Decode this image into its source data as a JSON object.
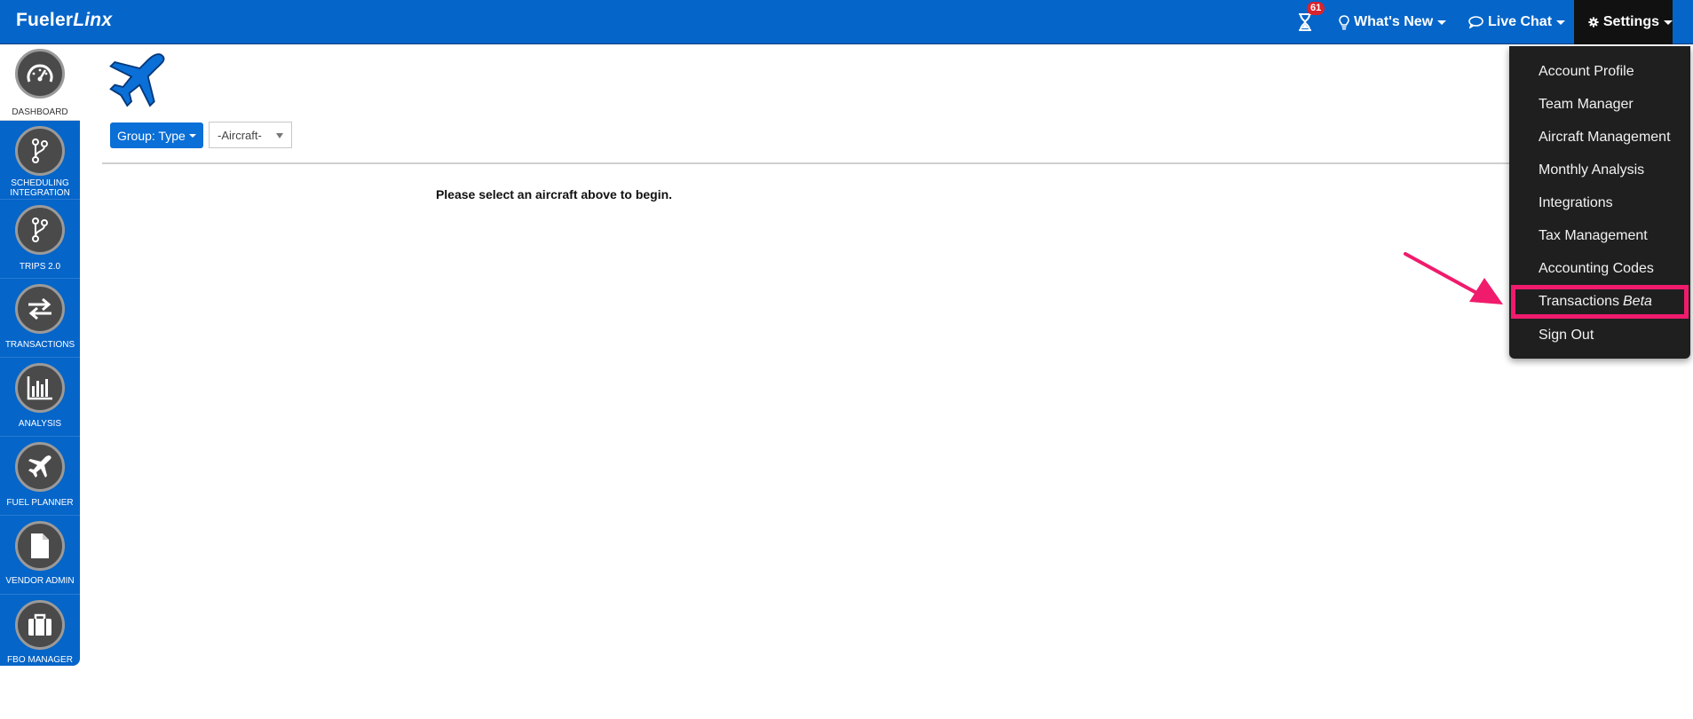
{
  "brand": {
    "part1": "Fueler",
    "part2": "Linx"
  },
  "topnav": {
    "notification_count": "61",
    "whats_new": "What's New",
    "live_chat": "Live Chat",
    "settings": "Settings"
  },
  "sidebar": {
    "items": [
      {
        "label": "Dashboard",
        "icon": "speedometer-icon"
      },
      {
        "label": "Scheduling Integration",
        "icon": "branch-icon"
      },
      {
        "label": "Trips 2.0",
        "icon": "branch-icon"
      },
      {
        "label": "Transactions",
        "icon": "exchange-icon"
      },
      {
        "label": "Analysis",
        "icon": "bar-chart-icon"
      },
      {
        "label": "Fuel Planner",
        "icon": "plane-icon"
      },
      {
        "label": "Vendor Admin",
        "icon": "document-icon"
      },
      {
        "label": "FBO Manager",
        "icon": "briefcase-icon"
      }
    ]
  },
  "toolbar": {
    "group_button": "Group: Type",
    "aircraft_select": "-Aircraft-"
  },
  "main": {
    "message": "Please select an aircraft above to begin."
  },
  "settings_menu": {
    "items": [
      "Account Profile",
      "Team Manager",
      "Aircraft Management",
      "Monthly Analysis",
      "Integrations",
      "Tax Management",
      "Accounting Codes",
      "Transactions",
      "Sign Out"
    ],
    "transactions_suffix": "Beta"
  },
  "colors": {
    "primary_blue": "#0565c9",
    "settings_dark": "#111111",
    "highlight": "#f01b6c",
    "badge_red": "#d9232d"
  }
}
